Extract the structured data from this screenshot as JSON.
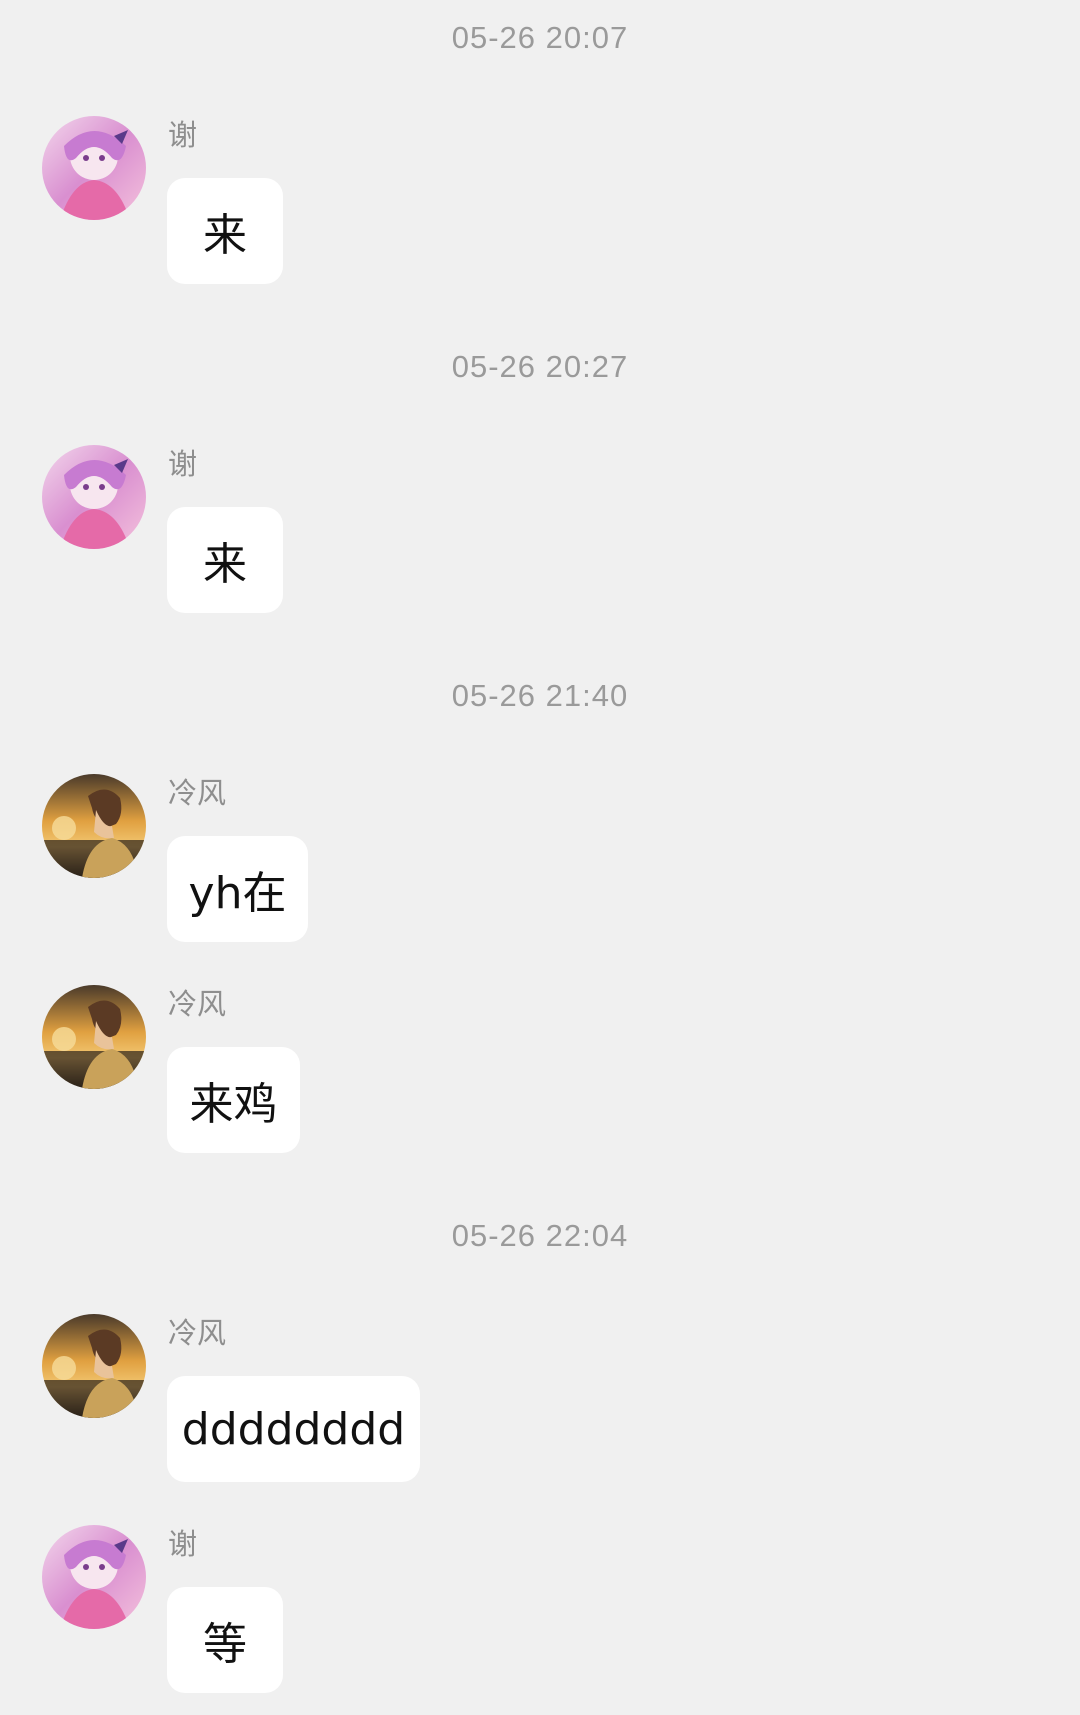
{
  "colors": {
    "background": "#f0f0f0",
    "bubble": "#ffffff",
    "timestamp_text": "#9a9a9a",
    "name_text": "#8e8e8e",
    "message_text": "#111111"
  },
  "avatars": {
    "xie": "anime-girl-pink-hair-avatar",
    "lengfeng": "anime-boy-sunset-avatar"
  },
  "timestamps": {
    "t1": "05-26 20:07",
    "t2": "05-26 20:27",
    "t3": "05-26 21:40",
    "t4": "05-26 22:04"
  },
  "messages": [
    {
      "sender": "谢",
      "text": "来"
    },
    {
      "sender": "谢",
      "text": "来"
    },
    {
      "sender": "冷风",
      "text": "yh在"
    },
    {
      "sender": "冷风",
      "text": "来鸡"
    },
    {
      "sender": "冷风",
      "text": "dddddddd"
    },
    {
      "sender": "谢",
      "text": "等"
    }
  ]
}
